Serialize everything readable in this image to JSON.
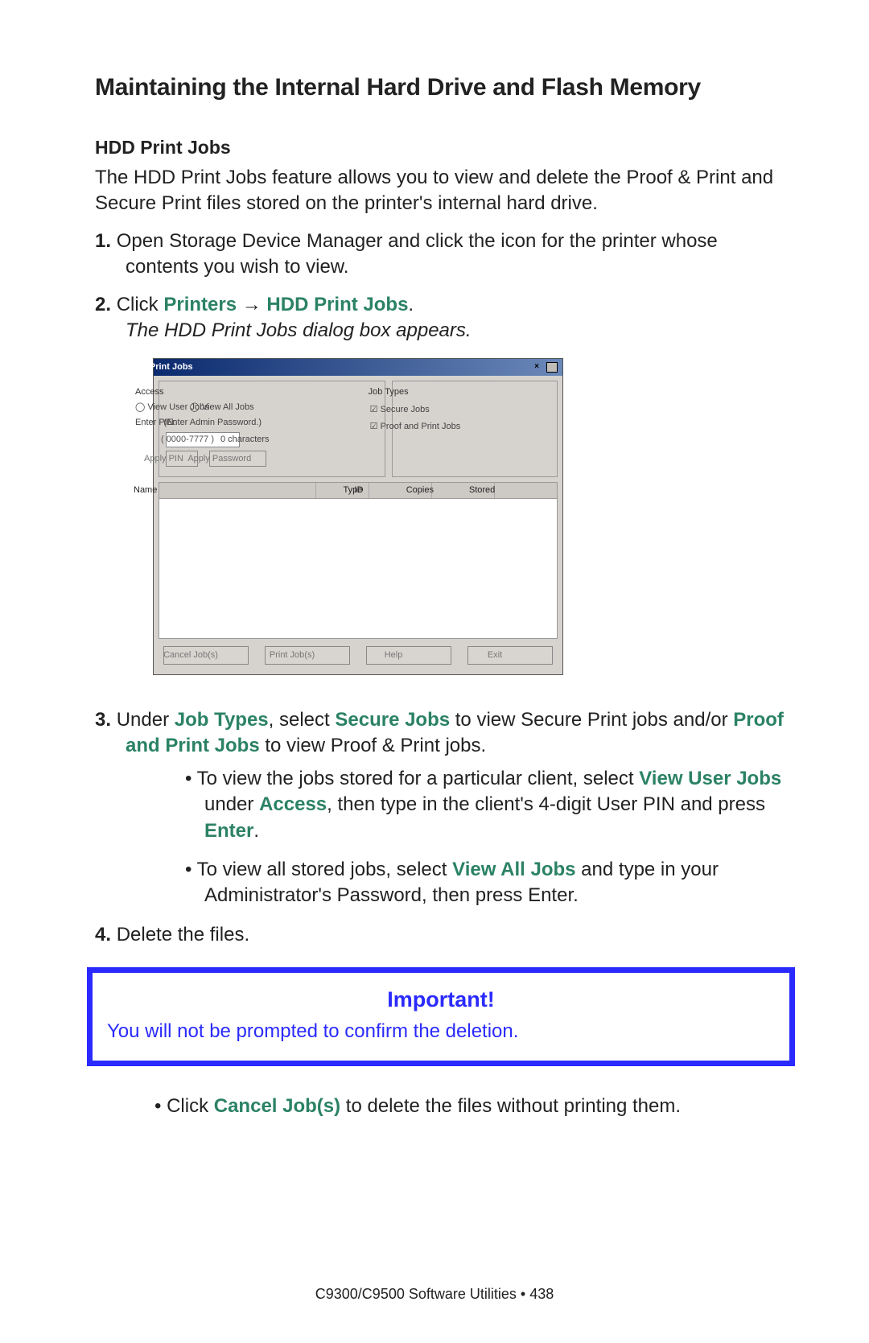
{
  "title": "Maintaining the Internal Hard Drive and Flash Memory",
  "subhead": "HDD Print Jobs",
  "intro": "The HDD Print Jobs feature allows you to view and delete the Proof & Print and Secure Print files stored on the printer's internal hard drive.",
  "steps": {
    "s1": "Open Storage Device Manager and click the icon for the printer whose contents you wish to view.",
    "s2_click": "Click ",
    "s2_printers": "Printers",
    "s2_arrow": " → ",
    "s2_hdd": "HDD Print Jobs",
    "s2_period": ".",
    "s2_result": "The HDD Print Jobs dialog box appears.",
    "s3_under": "Under ",
    "s3_jobtypes": "Job Types",
    "s3_sel": ", select ",
    "s3_secure": "Secure Jobs",
    "s3_mid": " to view Secure Print jobs and/or ",
    "s3_proof": "Proof and Print Jobs",
    "s3_end": " to view Proof & Print jobs.",
    "s4": "Delete the files."
  },
  "bullets_a": {
    "b1a": "To view the jobs stored for a particular client, select ",
    "b1_vu": "View User Jobs",
    "b1b": " under ",
    "b1_access": "Access",
    "b1c": ", then type in the client's 4-digit User PIN and press ",
    "b1_enter": "Enter",
    "b1d": ".",
    "b2a": "To view all stored jobs, select ",
    "b2_vaj": "View All Jobs",
    "b2b": " and type in your Administrator's Password, then press Enter."
  },
  "important": {
    "title": "Important!",
    "text": "You will not be prompted to confirm the deletion."
  },
  "after": {
    "a1_pre": "Click ",
    "a1_cancel": "Cancel Job(s)",
    "a1_post": " to delete the files without printing them."
  },
  "footer": "C9300/C9500 Software Utilities • 438",
  "dialog": {
    "title": "HDD Print Jobs",
    "access_label": "Access",
    "view_user": "View User Jobs",
    "view_all": "View All Jobs",
    "enter_pin": "Enter PIN:",
    "enter_adm": "(Enter Admin Password.)",
    "pin_hint": "( 0000-7777 )",
    "chars": "0 characters",
    "apply_pin": "Apply PIN",
    "apply_pw": "Apply Password",
    "jobtypes_label": "Job Types",
    "secure_jobs": "Secure Jobs",
    "proof_jobs": "Proof and Print Jobs",
    "col_name": "Name",
    "col_id": "ID",
    "col_type": "Type",
    "col_copies": "Copies",
    "col_stored": "Stored",
    "btn_cancel": "Cancel Job(s)",
    "btn_print": "Print Job(s)",
    "btn_help": "Help",
    "btn_exit": "Exit"
  }
}
